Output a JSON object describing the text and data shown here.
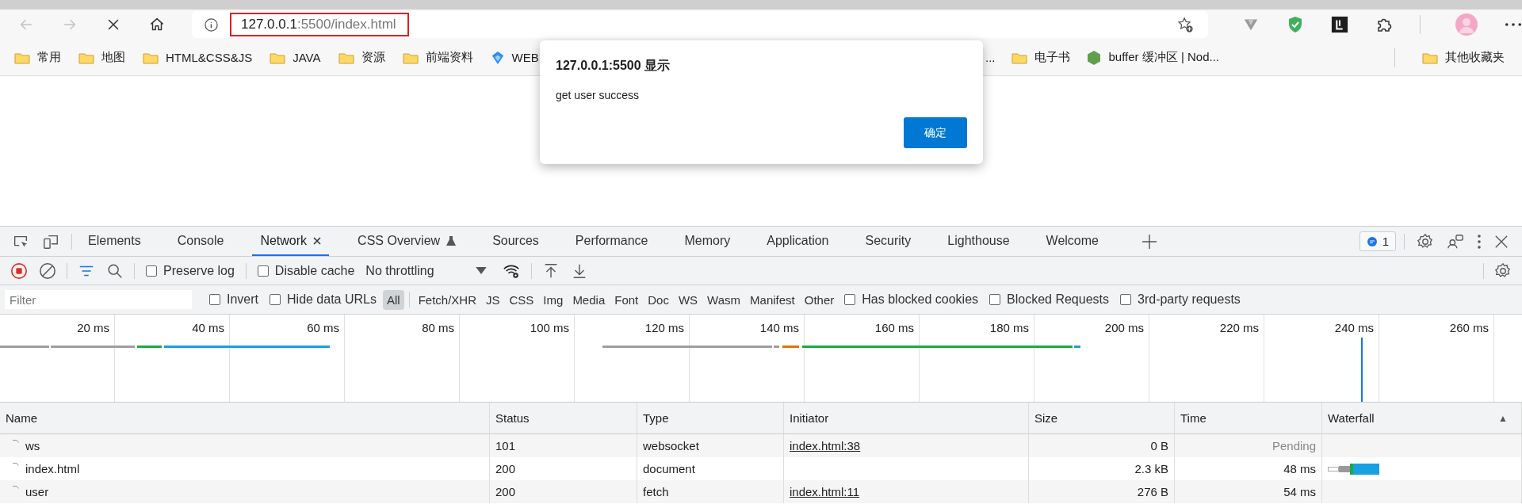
{
  "browser": {
    "nav": [
      {
        "kind": "back",
        "disabled": true
      },
      {
        "kind": "forward",
        "disabled": true
      },
      {
        "kind": "stop",
        "disabled": false
      },
      {
        "kind": "home",
        "disabled": false
      }
    ],
    "address": {
      "host": "127.0.0.1",
      "rest": ":5500/index.html"
    },
    "bookmarks_left": [
      {
        "label": "常用",
        "kind": "folder"
      },
      {
        "label": "地图",
        "kind": "folder"
      },
      {
        "label": "HTML&CSS&JS",
        "kind": "folder"
      },
      {
        "label": "JAVA",
        "kind": "folder"
      },
      {
        "label": "资源",
        "kind": "folder"
      },
      {
        "label": "前端资料",
        "kind": "folder"
      },
      {
        "label": "WEB",
        "kind": "site"
      }
    ],
    "bookmarks_right": [
      {
        "label": "...",
        "kind": "plain"
      },
      {
        "label": "电子书",
        "kind": "folder"
      },
      {
        "label": "buffer 缓冲区 | Nod...",
        "kind": "node"
      }
    ],
    "other_bookmarks": {
      "label": "其他收藏夹"
    }
  },
  "dialog": {
    "title": "127.0.0.1:5500 显示",
    "message": "get user success",
    "button": "确定"
  },
  "devtools": {
    "tabs": [
      {
        "label": "Elements",
        "selected": false
      },
      {
        "label": "Console",
        "selected": false
      },
      {
        "label": "Network",
        "selected": true,
        "closable": true
      },
      {
        "label": "CSS Overview",
        "selected": false,
        "experimental": true
      },
      {
        "label": "Sources",
        "selected": false
      },
      {
        "label": "Performance",
        "selected": false
      },
      {
        "label": "Memory",
        "selected": false
      },
      {
        "label": "Application",
        "selected": false
      },
      {
        "label": "Security",
        "selected": false
      },
      {
        "label": "Lighthouse",
        "selected": false
      },
      {
        "label": "Welcome",
        "selected": false
      }
    ],
    "issues_badge": "1",
    "toolbar": {
      "preserve_log": {
        "label": "Preserve log",
        "checked": false
      },
      "disable_cache": {
        "label": "Disable cache",
        "checked": false
      },
      "throttling": "No throttling"
    },
    "filter": {
      "placeholder": "Filter",
      "options": [
        {
          "label": "Invert",
          "checked": false
        },
        {
          "label": "Hide data URLs",
          "checked": false
        }
      ],
      "types": [
        {
          "label": "All",
          "selected": true
        },
        {
          "label": "Fetch/XHR",
          "selected": false
        },
        {
          "label": "JS",
          "selected": false
        },
        {
          "label": "CSS",
          "selected": false
        },
        {
          "label": "Img",
          "selected": false
        },
        {
          "label": "Media",
          "selected": false
        },
        {
          "label": "Font",
          "selected": false
        },
        {
          "label": "Doc",
          "selected": false
        },
        {
          "label": "WS",
          "selected": false
        },
        {
          "label": "Wasm",
          "selected": false
        },
        {
          "label": "Manifest",
          "selected": false
        },
        {
          "label": "Other",
          "selected": false
        }
      ],
      "extra": [
        {
          "label": "Has blocked cookies",
          "checked": false
        },
        {
          "label": "Blocked Requests",
          "checked": false
        },
        {
          "label": "3rd-party requests",
          "checked": false
        }
      ]
    },
    "overview_ticks": [
      "20 ms",
      "40 ms",
      "60 ms",
      "80 ms",
      "100 ms",
      "120 ms",
      "140 ms",
      "160 ms",
      "180 ms",
      "200 ms",
      "220 ms",
      "240 ms",
      "260 ms"
    ],
    "table": {
      "columns": [
        "Name",
        "Status",
        "Type",
        "Initiator",
        "Size",
        "Time",
        "Waterfall"
      ],
      "sort_mark": "▲",
      "rows": [
        {
          "name": "ws",
          "status": "101",
          "type": "websocket",
          "initiator": "index.html:38",
          "size": "0 B",
          "time": "Pending",
          "pending": true
        },
        {
          "name": "index.html",
          "status": "200",
          "type": "document",
          "size": "2.3 kB",
          "time": "48 ms",
          "pending": false,
          "bar": true
        },
        {
          "name": "user",
          "status": "200",
          "type": "fetch",
          "initiator": "index.html:11",
          "size": "276 B",
          "time": "54 ms",
          "pending": false
        }
      ]
    }
  }
}
